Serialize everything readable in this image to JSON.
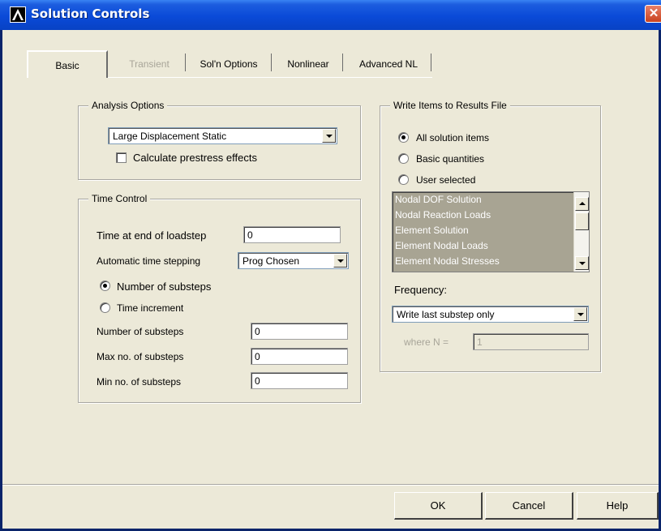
{
  "window": {
    "title": "Solution Controls",
    "close_glyph": "✕",
    "icon": "ansys-logo-icon"
  },
  "tabs": [
    {
      "label": "Basic",
      "state": "active"
    },
    {
      "label": "Transient",
      "state": "disabled"
    },
    {
      "label": "Sol'n Options",
      "state": "normal"
    },
    {
      "label": "Nonlinear",
      "state": "normal"
    },
    {
      "label": "Advanced NL",
      "state": "normal"
    }
  ],
  "analysis_options": {
    "legend": "Analysis Options",
    "type_selected": "Large Displacement Static",
    "prestress_label": "Calculate prestress effects",
    "prestress_checked": false
  },
  "time_control": {
    "legend": "Time Control",
    "end_time_label": "Time at end of loadstep",
    "end_time_value": "0",
    "auto_step_label": "Automatic time stepping",
    "auto_step_selected": "Prog Chosen",
    "radio_substeps_label": "Number of substeps",
    "radio_increment_label": "Time increment",
    "num_substeps_label": "Number of substeps",
    "num_substeps_value": "0",
    "max_substeps_label": "Max no. of substeps",
    "max_substeps_value": "0",
    "min_substeps_label": "Min no. of substeps",
    "min_substeps_value": "0"
  },
  "results_file": {
    "legend": "Write Items to Results File",
    "radio_all": "All solution items",
    "radio_basic": "Basic quantities",
    "radio_user": "User selected",
    "list_items": [
      "Nodal DOF Solution",
      "Nodal Reaction Loads",
      "Element Solution",
      "Element Nodal Loads",
      "Element Nodal Stresses"
    ],
    "frequency_label": "Frequency:",
    "frequency_selected": "Write last substep only",
    "where_n_label": "where N =",
    "where_n_value": "1"
  },
  "buttons": {
    "ok": "OK",
    "cancel": "Cancel",
    "help": "Help"
  },
  "colors": {
    "title_bar": "#0a4ad8",
    "dialog_bg": "#ece9d8",
    "list_bg": "#a8a493"
  }
}
